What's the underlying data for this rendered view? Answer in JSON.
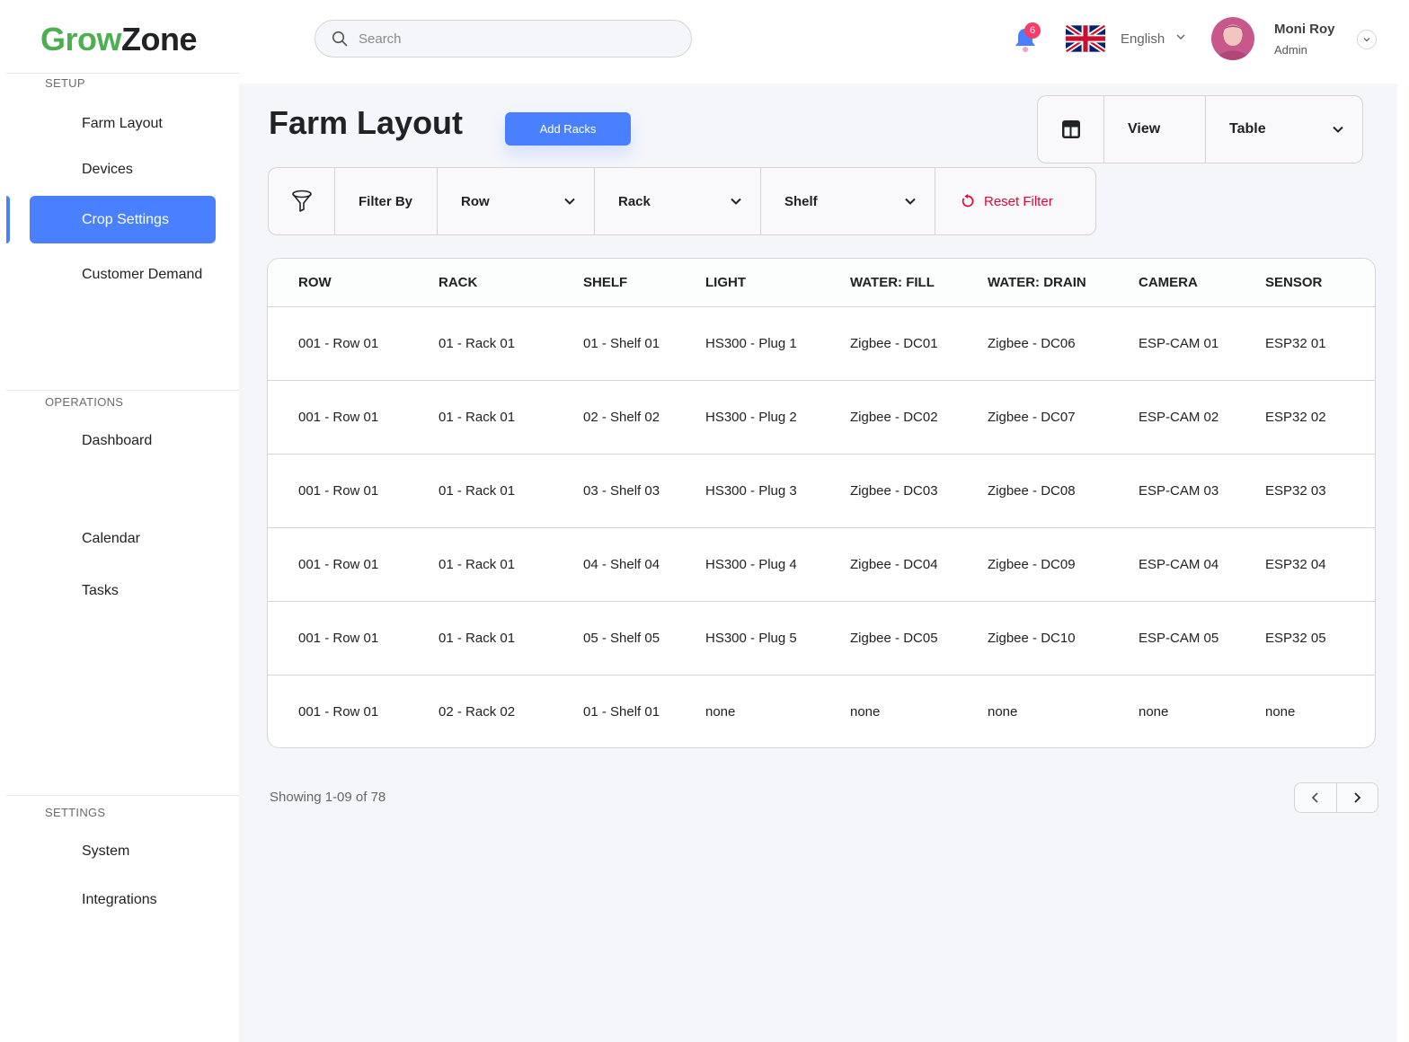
{
  "app": {
    "logo_part1": "Grow",
    "logo_part2": "Zone"
  },
  "sidebar": {
    "setup_title": "SETUP",
    "setup_items": [
      {
        "label": "Farm Layout"
      },
      {
        "label": "Devices"
      },
      {
        "label": "Crop Settings",
        "active": true
      },
      {
        "label": "Customer Demand"
      }
    ],
    "operations_title": "OPERATIONS",
    "operations_items": [
      {
        "label": "Dashboard"
      },
      {
        "label": "Calendar"
      },
      {
        "label": "Tasks"
      }
    ],
    "settings_title": "SETTINGS",
    "settings_items": [
      {
        "label": "System"
      },
      {
        "label": "Integrations"
      }
    ]
  },
  "topbar": {
    "search_placeholder": "Search",
    "notification_count": "6",
    "language": "English",
    "user_name": "Moni Roy",
    "user_role": "Admin"
  },
  "page": {
    "title": "Farm Layout",
    "add_button": "Add Racks",
    "view_label": "View",
    "view_value": "Table"
  },
  "filters": {
    "filter_by": "Filter By",
    "row": "Row",
    "rack": "Rack",
    "shelf": "Shelf",
    "reset": "Reset Filter"
  },
  "table": {
    "headers": [
      "ROW",
      "RACK",
      "SHELF",
      "LIGHT",
      "WATER: FILL",
      "WATER: DRAIN",
      "CAMERA",
      "SENSOR"
    ],
    "rows": [
      [
        "001 - Row 01",
        "01 - Rack 01",
        "01 - Shelf 01",
        "HS300 - Plug 1",
        "Zigbee - DC01",
        "Zigbee - DC06",
        "ESP-CAM 01",
        "ESP32 01"
      ],
      [
        "001 - Row 01",
        "01 - Rack 01",
        "02 - Shelf 02",
        "HS300 - Plug 2",
        "Zigbee - DC02",
        "Zigbee - DC07",
        "ESP-CAM 02",
        "ESP32 02"
      ],
      [
        "001 - Row 01",
        "01 - Rack 01",
        "03 - Shelf 03",
        "HS300 - Plug 3",
        "Zigbee - DC03",
        "Zigbee - DC08",
        "ESP-CAM 03",
        "ESP32 03"
      ],
      [
        "001 - Row 01",
        "01 - Rack 01",
        "04 - Shelf 04",
        "HS300 - Plug 4",
        "Zigbee - DC04",
        "Zigbee - DC09",
        "ESP-CAM 04",
        "ESP32 04"
      ],
      [
        "001 - Row 01",
        "01 - Rack 01",
        "05 - Shelf 05",
        "HS300 - Plug 5",
        "Zigbee - DC05",
        "Zigbee - DC10",
        "ESP-CAM 05",
        "ESP32 05"
      ],
      [
        "001 - Row 01",
        "02 - Rack 02",
        "01 - Shelf 01",
        "none",
        "none",
        "none",
        "none",
        "none"
      ]
    ]
  },
  "footer": {
    "showing": "Showing 1-09 of 78"
  },
  "colors": {
    "accent": "#4880ff",
    "brand_green": "#4caf50",
    "danger": "#ea0234",
    "badge": "#f93c65"
  }
}
